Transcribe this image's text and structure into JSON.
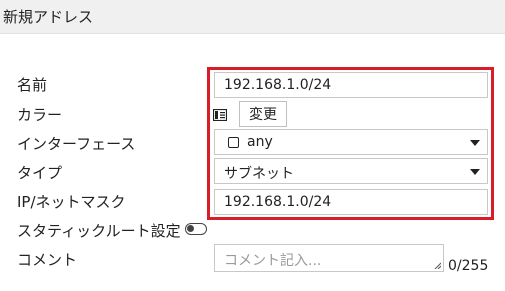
{
  "header": {
    "title": "新規アドレス"
  },
  "form": {
    "name": {
      "label": "名前",
      "value": "192.168.1.0/24"
    },
    "color": {
      "label": "カラー",
      "button_label": "変更",
      "icon": "color-swatch-icon"
    },
    "interface": {
      "label": "インターフェース",
      "value": "any",
      "icon": "interface-icon"
    },
    "type": {
      "label": "タイプ",
      "value": "サブネット"
    },
    "ip_netmask": {
      "label": "IP/ネットマスク",
      "value": "192.168.1.0/24"
    },
    "static_route": {
      "label": "スタティックルート設定",
      "enabled": false
    },
    "comment": {
      "label": "コメント",
      "placeholder": "コメント記入...",
      "counter": "0/255"
    }
  },
  "colors": {
    "highlight": "#d81c28",
    "header_bg": "#f0f0f0",
    "field_border": "#c8c8c8"
  }
}
